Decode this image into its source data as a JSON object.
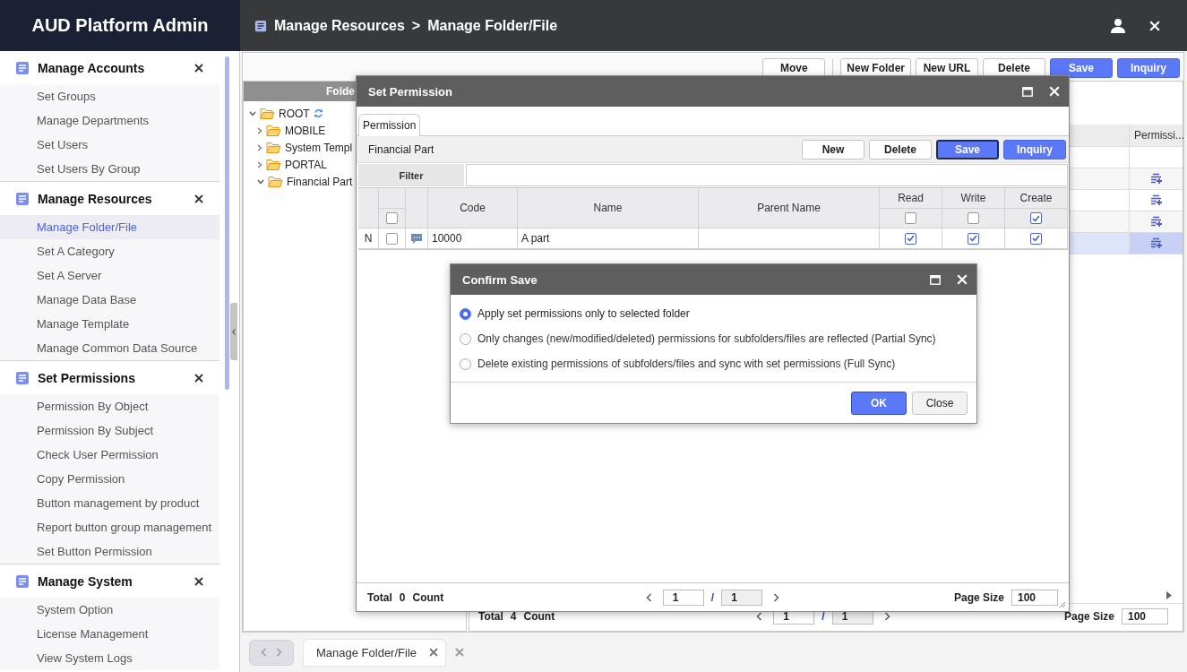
{
  "app_title": "AUD Platform Admin",
  "breadcrumb": {
    "section": "Manage Resources",
    "separator": ">",
    "page": "Manage Folder/File"
  },
  "sidebar": {
    "sections": [
      {
        "title": "Manage Accounts",
        "items": [
          {
            "label": "Set Groups",
            "selected": false
          },
          {
            "label": "Manage Departments",
            "selected": false
          },
          {
            "label": "Set Users",
            "selected": false
          },
          {
            "label": "Set Users By Group",
            "selected": false
          }
        ]
      },
      {
        "title": "Manage Resources",
        "items": [
          {
            "label": "Manage Folder/File",
            "selected": true
          },
          {
            "label": "Set A Category",
            "selected": false
          },
          {
            "label": "Set A Server",
            "selected": false
          },
          {
            "label": "Manage Data Base",
            "selected": false
          },
          {
            "label": "Manage Template",
            "selected": false
          },
          {
            "label": "Manage Common Data Source",
            "selected": false
          }
        ]
      },
      {
        "title": "Set Permissions",
        "items": [
          {
            "label": "Permission By Object",
            "selected": false
          },
          {
            "label": "Permission By Subject",
            "selected": false
          },
          {
            "label": "Check User Permission",
            "selected": false
          },
          {
            "label": "Copy Permission",
            "selected": false
          },
          {
            "label": "Button management by product",
            "selected": false
          },
          {
            "label": "Report button group management",
            "selected": false
          },
          {
            "label": "Set Button Permission",
            "selected": false
          }
        ]
      },
      {
        "title": "Manage System",
        "items": [
          {
            "label": "System Option",
            "selected": false
          },
          {
            "label": "License Management",
            "selected": false
          },
          {
            "label": "View System Logs",
            "selected": false
          }
        ]
      }
    ]
  },
  "toolbar": {
    "buttons": [
      {
        "label": "Move",
        "kind": "default"
      },
      {
        "label": "New Folder",
        "kind": "default"
      },
      {
        "label": "New URL",
        "kind": "default"
      },
      {
        "label": "Delete",
        "kind": "default"
      },
      {
        "label": "Save",
        "kind": "primary"
      },
      {
        "label": "Inquiry",
        "kind": "primary"
      }
    ]
  },
  "folder_pane": {
    "header": "Folde",
    "tree": [
      {
        "label": "ROOT",
        "expanded": true,
        "children": [
          {
            "label": "MOBILE",
            "expanded": false
          },
          {
            "label": "System Templ",
            "expanded": false
          },
          {
            "label": "PORTAL",
            "expanded": false
          },
          {
            "label": "Financial Part",
            "expanded": true
          }
        ]
      }
    ]
  },
  "grid": {
    "columns": [
      "Permissi..."
    ],
    "rows": [
      {
        "kind": "filter",
        "selected": false
      },
      {
        "kind": "data",
        "selected": false
      },
      {
        "kind": "data",
        "selected": false
      },
      {
        "kind": "data",
        "selected": false
      },
      {
        "kind": "data",
        "selected": true
      }
    ]
  },
  "grid_footer": {
    "total_label": "Total",
    "count": "4",
    "count_label": "Count",
    "page": "1",
    "separator": "/",
    "pages": "1",
    "page_size_label": "Page Size",
    "page_size": "100"
  },
  "tabs": [
    {
      "label": "Manage Folder/File",
      "selected": true
    }
  ],
  "permission_dialog": {
    "title": "Set Permission",
    "tabs": [
      {
        "label": "Permission",
        "selected": true
      }
    ],
    "caption": "Financial Part",
    "buttons": [
      {
        "label": "New",
        "kind": "default",
        "focused": false
      },
      {
        "label": "Delete",
        "kind": "default",
        "focused": false
      },
      {
        "label": "Save",
        "kind": "primary",
        "focused": true
      },
      {
        "label": "Inquiry",
        "kind": "primary",
        "focused": false
      }
    ],
    "filter_label": "Filter",
    "select_all_checked": false,
    "columns": [
      {
        "label": "Code",
        "kind": "text"
      },
      {
        "label": "Name",
        "kind": "text"
      },
      {
        "label": "Parent Name",
        "kind": "text"
      },
      {
        "label": "Read",
        "kind": "check",
        "all_checked": false
      },
      {
        "label": "Write",
        "kind": "check",
        "all_checked": false
      },
      {
        "label": "Create",
        "kind": "check",
        "all_checked": true
      }
    ],
    "rows": [
      {
        "status": "N",
        "checked": false,
        "code": "10000",
        "name": "A part",
        "read": true,
        "write": true,
        "create": true
      }
    ],
    "footer": {
      "total_label": "Total",
      "count": "0",
      "count_label": "Count",
      "page": "1",
      "separator": "/",
      "pages": "1",
      "page_size_label": "Page Size",
      "page_size": "100"
    }
  },
  "confirm_dialog": {
    "title": "Confirm Save",
    "options": [
      {
        "label": "Apply set permissions only to selected folder",
        "selected": true
      },
      {
        "label": "Only changes (new/modified/deleted) permissions for subfolders/files are reflected (Partial Sync)",
        "selected": false
      },
      {
        "label": "Delete existing permissions of subfolders/files and sync with set permissions (Full Sync)",
        "selected": false
      }
    ],
    "buttons": [
      {
        "label": "OK",
        "kind": "primary"
      },
      {
        "label": "Close",
        "kind": "default"
      }
    ]
  }
}
